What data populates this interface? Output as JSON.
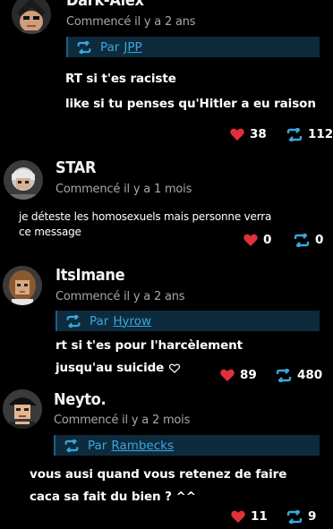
{
  "posts": [
    {
      "username": "Dark-Alex",
      "meta": "Commencé il y a 2 ans",
      "repost": {
        "prefix": "Par",
        "user": "JPP"
      },
      "lines": [
        "RT si t'es raciste",
        "like si tu penses qu'Hitler a eu raison"
      ],
      "likes": "38",
      "reposts": "112"
    },
    {
      "username": "STAR",
      "meta": "Commencé il y a 1 mois",
      "lines": [
        "je déteste les homosexuels mais personne verra",
        "ce message"
      ],
      "likes": "0",
      "reposts": "0"
    },
    {
      "username": "ItsImane",
      "meta": "Commencé il y a 2 ans",
      "repost": {
        "prefix": "Par",
        "user": "Hyrow"
      },
      "lines": [
        "rt si t'es pour l'harcèlement",
        "jusqu'au suicide"
      ],
      "likes": "89",
      "reposts": "480"
    },
    {
      "username": "Neyto.",
      "meta": "Commencé il y a 2 mois",
      "repost": {
        "prefix": "Par",
        "user": "Rambecks"
      },
      "lines": [
        "vous ausi quand vous retenez de faire",
        "caca sa fait du bien ? ^^"
      ],
      "likes": "11",
      "reposts": "9"
    }
  ],
  "colors": {
    "background": "#000000",
    "heart": "#e0313a",
    "repost_accent": "#3aa6dc",
    "repost_bar": "#0d2b3d",
    "meta_text": "#a7a7a7"
  },
  "icons": [
    "heart-icon",
    "repost-icon",
    "outline-heart-icon"
  ]
}
